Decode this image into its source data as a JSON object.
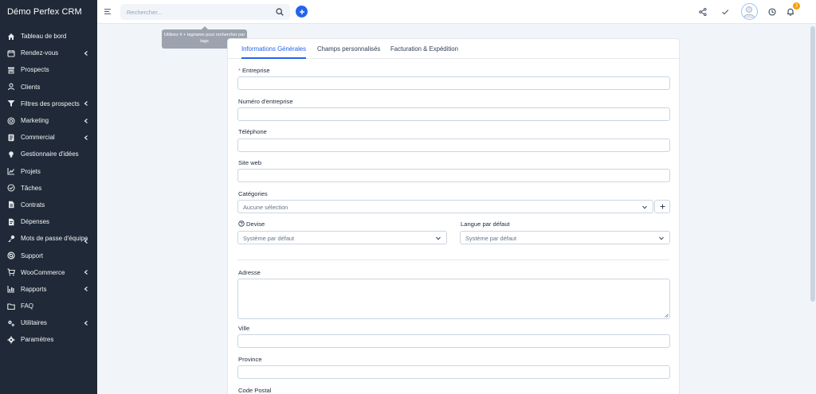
{
  "brand": "Démo Perfex CRM",
  "sidebar": {
    "items": [
      {
        "label": "Tableau de bord",
        "icon": "home-icon",
        "chevron": false
      },
      {
        "label": "Rendez-vous",
        "icon": "calendar-icon",
        "chevron": true
      },
      {
        "label": "Prospects",
        "icon": "prospects-icon",
        "chevron": false
      },
      {
        "label": "Clients",
        "icon": "user-icon",
        "chevron": false
      },
      {
        "label": "Filtres des prospects",
        "icon": "filter-icon",
        "chevron": true
      },
      {
        "label": "Marketing",
        "icon": "target-icon",
        "chevron": true
      },
      {
        "label": "Commercial",
        "icon": "document-icon",
        "chevron": true
      },
      {
        "label": "Gestionnaire d'idées",
        "icon": "lightbulb-icon",
        "chevron": false
      },
      {
        "label": "Projets",
        "icon": "chart-icon",
        "chevron": false
      },
      {
        "label": "Tâches",
        "icon": "check-circle-icon",
        "chevron": false
      },
      {
        "label": "Contrats",
        "icon": "file-icon",
        "chevron": false
      },
      {
        "label": "Dépenses",
        "icon": "receipt-icon",
        "chevron": false
      },
      {
        "label": "Mots de passe d'équipe",
        "icon": "key-icon",
        "chevron": true
      },
      {
        "label": "Support",
        "icon": "lifebuoy-icon",
        "chevron": false
      },
      {
        "label": "WooCommerce",
        "icon": "cart-icon",
        "chevron": true
      },
      {
        "label": "Rapports",
        "icon": "bar-chart-icon",
        "chevron": true
      },
      {
        "label": "FAQ",
        "icon": "folder-icon",
        "chevron": false
      },
      {
        "label": "Utilitaires",
        "icon": "cogs-icon",
        "chevron": true
      },
      {
        "label": "Paramètres",
        "icon": "gear-icon",
        "chevron": false
      }
    ]
  },
  "header": {
    "search_placeholder": "Rechercher...",
    "tooltip": "Utilisez # + tagname pour rechercher par tags",
    "notification_count": "3"
  },
  "tabs": [
    {
      "label": "Informations Générales",
      "active": true
    },
    {
      "label": "Champs personnalisés",
      "active": false
    },
    {
      "label": "Facturation & Expédition",
      "active": false
    }
  ],
  "form": {
    "required_mark": "*",
    "company_label": "Entreprise",
    "company_number_label": "Numéro d'entreprise",
    "phone_label": "Téléphone",
    "website_label": "Site web",
    "categories_label": "Catégories",
    "categories_value": "Aucune sélection",
    "currency_label": "Devise",
    "currency_value": "Système par défaut",
    "language_label": "Langue par défaut",
    "language_value": "Système par défaut",
    "address_label": "Adresse",
    "city_label": "Ville",
    "province_label": "Province",
    "postal_label": "Code Postal"
  },
  "colors": {
    "sidebar_bg": "#1f2937",
    "accent": "#2563eb",
    "badge": "#f59e0b"
  }
}
